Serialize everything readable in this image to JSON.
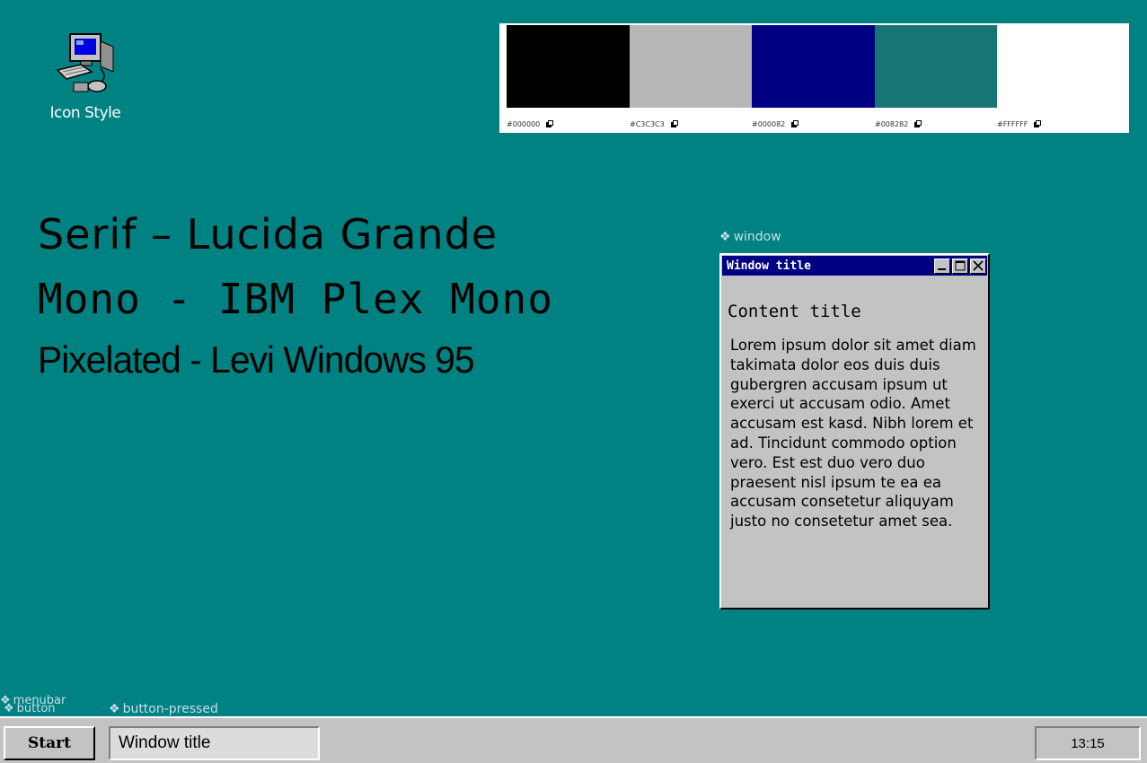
{
  "desktop": {
    "icon_label": "Icon Style",
    "icon_name": "computer-icon"
  },
  "palette": {
    "swatches": [
      {
        "hex": "#000000",
        "label": "#000000"
      },
      {
        "hex": "#C3C3C3",
        "label": "#C3C3C3"
      },
      {
        "hex": "#000082",
        "label": "#000082"
      },
      {
        "hex": "#008282",
        "label": "#008282"
      },
      {
        "hex": "#FFFFFF",
        "label": "#FFFFFF"
      }
    ],
    "copy_icon": "copy-icon"
  },
  "fonts": {
    "serif": "Serif – Lucida Grande",
    "mono": "Mono - IBM Plex Mono",
    "pixel": "Pixelated - Levi Windows 95"
  },
  "labels": {
    "window": "window",
    "menubar": "menubar",
    "button": "button",
    "button_pressed": "button-pressed"
  },
  "window": {
    "title": "Window title",
    "content_title": "Content title",
    "content_body": "Lorem ipsum dolor sit amet diam takimata dolor eos duis duis gubergren accusam ipsum ut exerci ut accusam odio. Amet accusam est kasd. Nibh lorem et ad. Tincidunt commodo option vero. Est est duo vero duo praesent nisl ipsum te ea ea accusam consetetur aliquyam justo no consetetur amet sea.",
    "buttons": [
      "minimize-icon",
      "maximize-icon",
      "close-icon"
    ]
  },
  "taskbar": {
    "start_label": "Start",
    "task_label": "Window title",
    "clock": "13:15"
  },
  "colors": {
    "desktop": "#008282",
    "title_bar": "#000082",
    "face": "#C3C3C3",
    "label": "#C6DDF0"
  }
}
